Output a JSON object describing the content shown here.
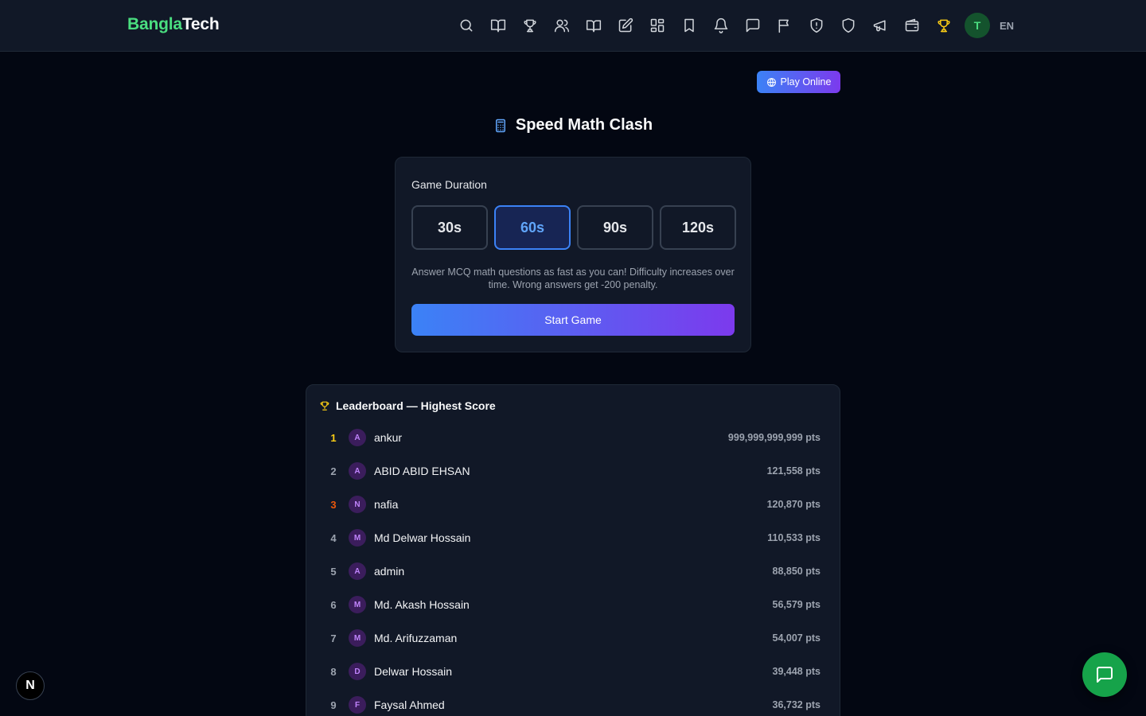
{
  "header": {
    "logo_part1": "Bangla",
    "logo_part2": "Tech",
    "nav_icons": [
      "search-icon",
      "book-open-icon",
      "trophy-icon",
      "users-icon",
      "book-icon",
      "edit-icon",
      "grid-icon",
      "bookmark-icon",
      "bell-icon",
      "message-icon",
      "flag-icon",
      "shield-alert-icon",
      "shield-icon",
      "megaphone-icon",
      "wallet-icon",
      "trophy-active-icon"
    ],
    "avatar_initial": "T",
    "language": "EN",
    "active_color": "#facc15"
  },
  "play_online_label": "Play Online",
  "title": "Speed Math Clash",
  "game": {
    "duration_label": "Game Duration",
    "durations": [
      "30s",
      "60s",
      "90s",
      "120s"
    ],
    "selected": "60s",
    "description": "Answer MCQ math questions as fast as you can! Difficulty increases over time. Wrong answers get -200 penalty.",
    "start_label": "Start Game"
  },
  "leaderboard": {
    "title": "Leaderboard — Highest Score",
    "rows": [
      {
        "rank": "1",
        "initial": "A",
        "name": "ankur",
        "points": "999,999,999,999 pts"
      },
      {
        "rank": "2",
        "initial": "A",
        "name": "ABID ABID EHSAN",
        "points": "121,558 pts"
      },
      {
        "rank": "3",
        "initial": "N",
        "name": "nafia",
        "points": "120,870 pts"
      },
      {
        "rank": "4",
        "initial": "M",
        "name": "Md Delwar Hossain",
        "points": "110,533 pts"
      },
      {
        "rank": "5",
        "initial": "A",
        "name": "admin",
        "points": "88,850 pts"
      },
      {
        "rank": "6",
        "initial": "M",
        "name": "Md. Akash Hossain",
        "points": "56,579 pts"
      },
      {
        "rank": "7",
        "initial": "M",
        "name": "Md. Arifuzzaman",
        "points": "54,007 pts"
      },
      {
        "rank": "8",
        "initial": "D",
        "name": "Delwar Hossain",
        "points": "39,448 pts"
      },
      {
        "rank": "9",
        "initial": "F",
        "name": "Faysal Ahmed",
        "points": "36,732 pts"
      }
    ]
  },
  "next_badge": "N",
  "colors": {
    "brand_green": "#4ade80",
    "accent_blue": "#3b82f6",
    "accent_purple": "#7c3aed",
    "chat_green": "#16a34a"
  }
}
